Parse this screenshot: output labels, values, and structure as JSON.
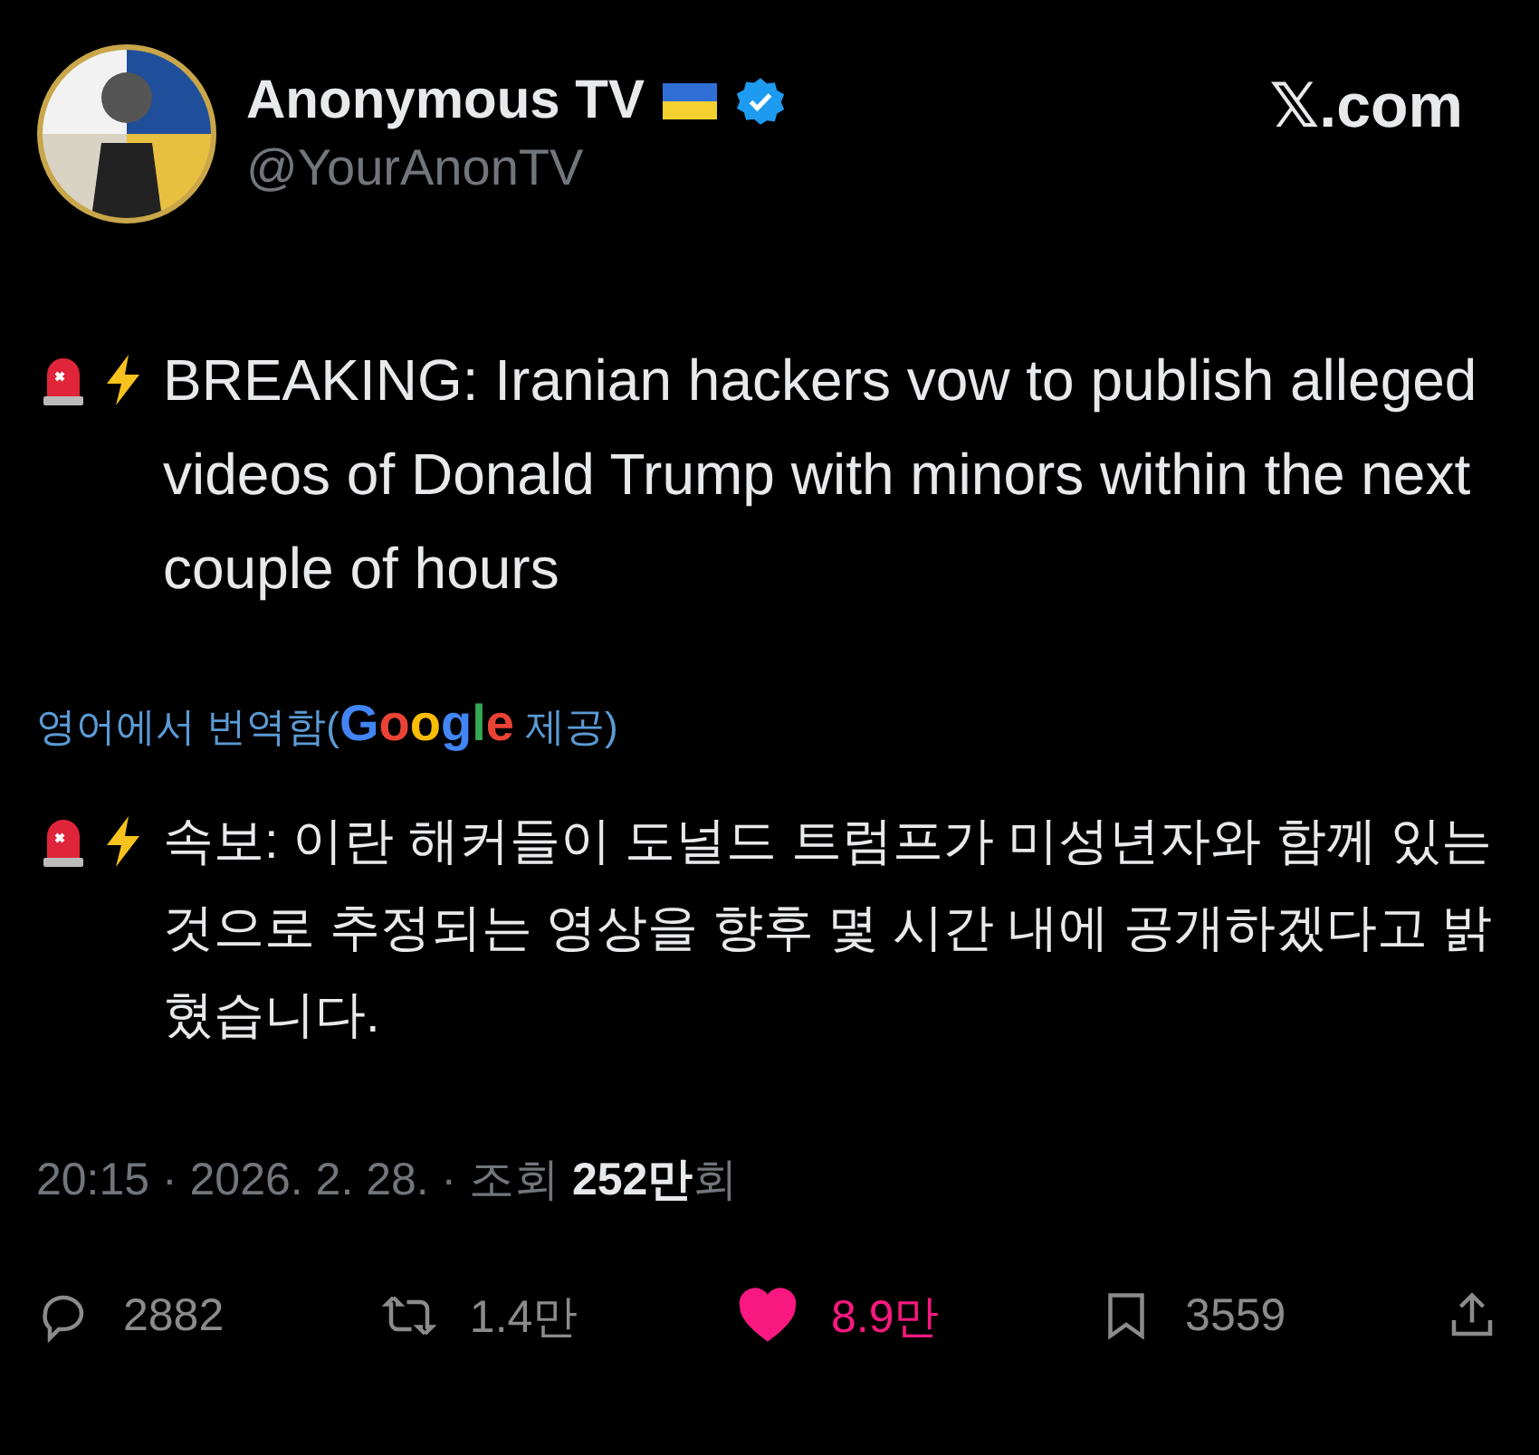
{
  "author": {
    "name": "Anonymous TV",
    "verified": true,
    "handle": "@YourAnonTV"
  },
  "site": "𝕏.com",
  "tweet": {
    "text": "BREAKING: Iranian hackers vow to publish alleged videos of Donald Trump with minors within the next couple of hours"
  },
  "translation": {
    "label": "영어에서 번역함(",
    "provider": "Google",
    "suffix": " 제공)",
    "text": "속보: 이란 해커들이 도널드 트럼프가 미성년자와 함께 있는 것으로 추정되는 영상을 향후 몇 시간 내에 공개하겠다고 밝혔습니다."
  },
  "meta": "20:15 · 2026. 2. 28. · 조회 **252만**회",
  "actions": [
    {
      "kind": "reply",
      "count": "2882",
      "selected": false
    },
    {
      "kind": "repost",
      "count": "1.4만",
      "selected": false
    },
    {
      "kind": "like",
      "count": "8.9만",
      "selected": true
    },
    {
      "kind": "bookmark",
      "count": "3559",
      "selected": false
    },
    {
      "kind": "share",
      "selected": false
    }
  ]
}
